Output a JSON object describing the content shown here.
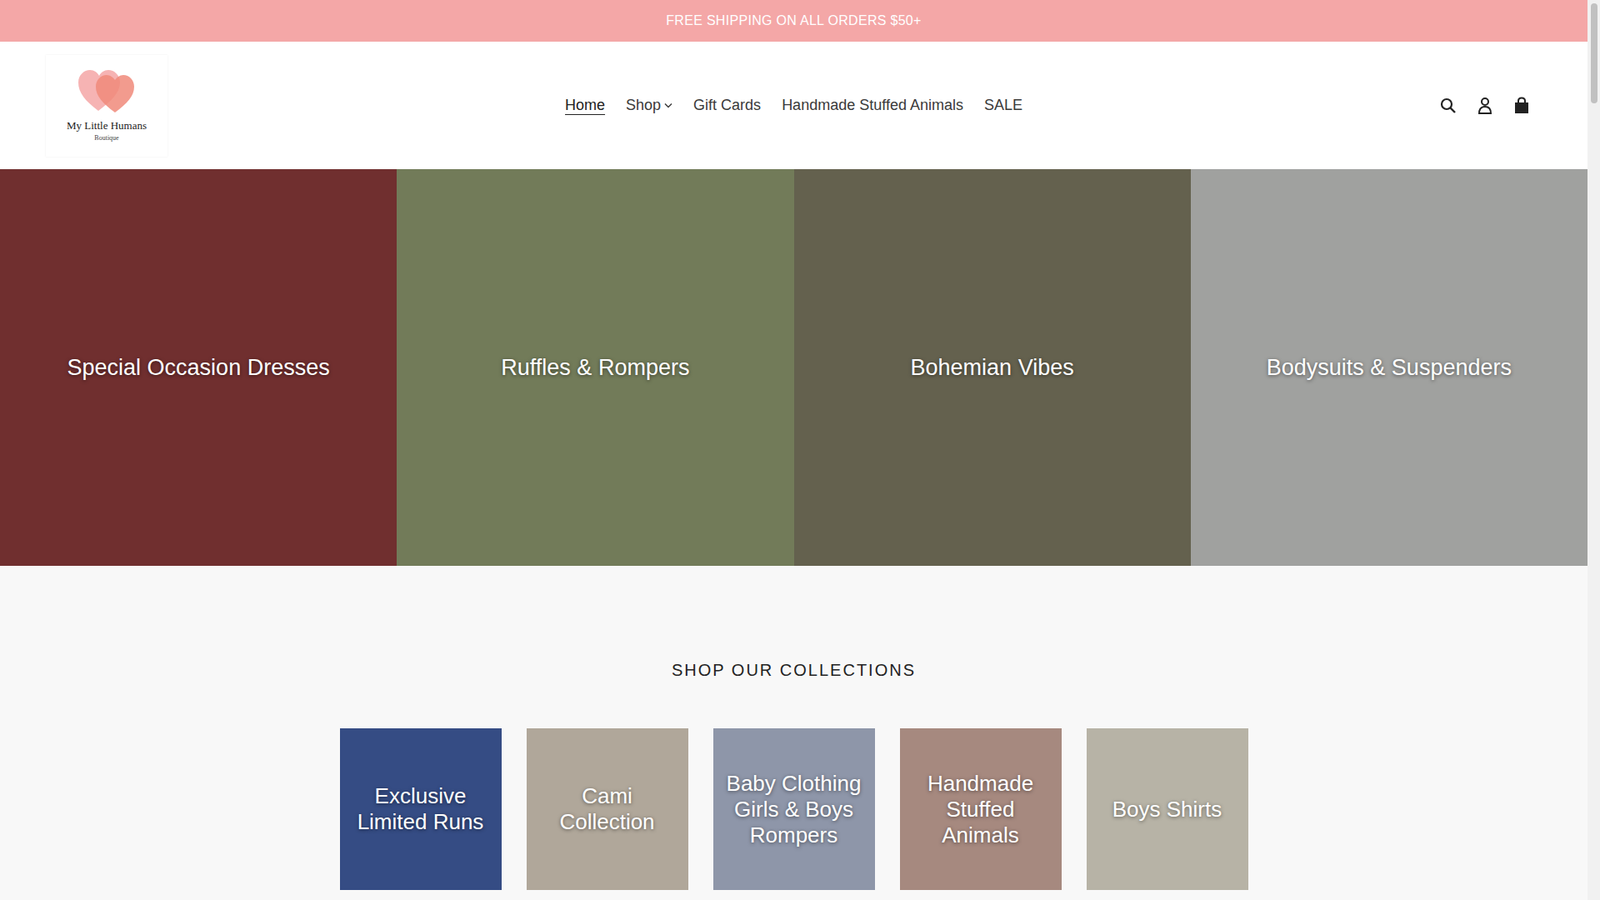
{
  "announcement": "FREE SHIPPING ON ALL ORDERS $50+",
  "logo": {
    "name": "My Little Humans",
    "subtitle": "Boutique"
  },
  "nav": [
    {
      "label": "Home",
      "selected": true,
      "kind": "link"
    },
    {
      "label": "Shop",
      "selected": false,
      "kind": "dropdown"
    },
    {
      "label": "Gift Cards",
      "selected": false,
      "kind": "link"
    },
    {
      "label": "Handmade Stuffed Animals",
      "selected": false,
      "kind": "link"
    },
    {
      "label": "SALE",
      "selected": false,
      "kind": "link"
    }
  ],
  "hero": [
    {
      "label": "Special Occasion Dresses"
    },
    {
      "label": "Ruffles & Rompers"
    },
    {
      "label": "Bohemian Vibes"
    },
    {
      "label": "Bodysuits & Suspenders"
    }
  ],
  "section_title": "SHOP OUR COLLECTIONS",
  "collections": [
    {
      "label": "Exclusive Limited Runs"
    },
    {
      "label": "Cami Collection"
    },
    {
      "label": "Baby Clothing Girls & Boys Rompers"
    },
    {
      "label": "Handmade Stuffed Animals"
    },
    {
      "label": "Boys Shirts"
    }
  ]
}
